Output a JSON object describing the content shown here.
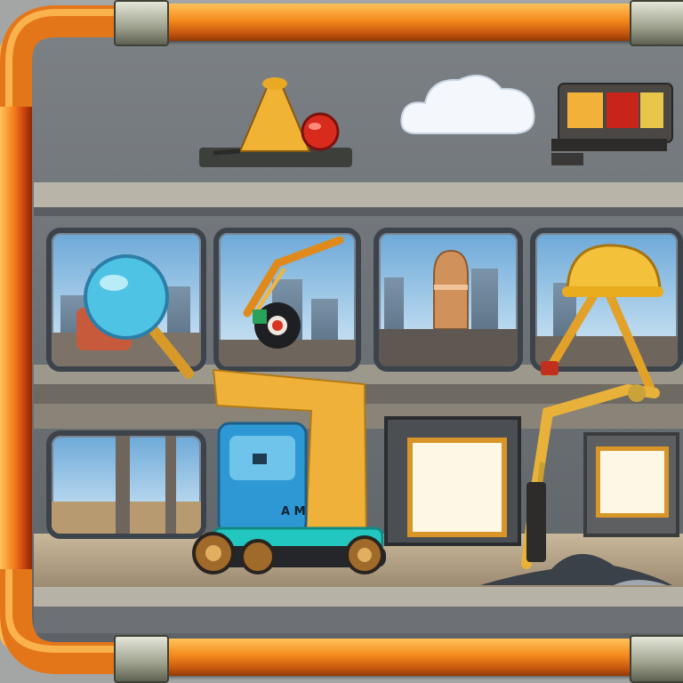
{
  "scene": {
    "theme": "construction-site",
    "colors": {
      "pipe": "#f48a1c",
      "wall": "#6e7378",
      "sky": "#8fc3e8",
      "machine_yellow": "#f2b23a",
      "machine_blue": "#2f9bd8",
      "teal": "#21c7c0"
    }
  },
  "top_shelf": {
    "items": [
      "hard-hat-cone-icon",
      "red-button-icon",
      "cloud-icon",
      "control-panel-icon"
    ]
  },
  "windows": [
    {
      "content": "magnifier-icon"
    },
    {
      "content": "crane-arm-icon"
    },
    {
      "content": "observatory-tower-icon"
    },
    {
      "content": "hard-hat-tripod-icon"
    }
  ],
  "lower_floor": {
    "machine": {
      "label": "A M"
    },
    "items": [
      "bulldozer-icon",
      "blank-panel",
      "excavator-arm-icon",
      "blank-panel",
      "rubble-pile-icon"
    ]
  }
}
